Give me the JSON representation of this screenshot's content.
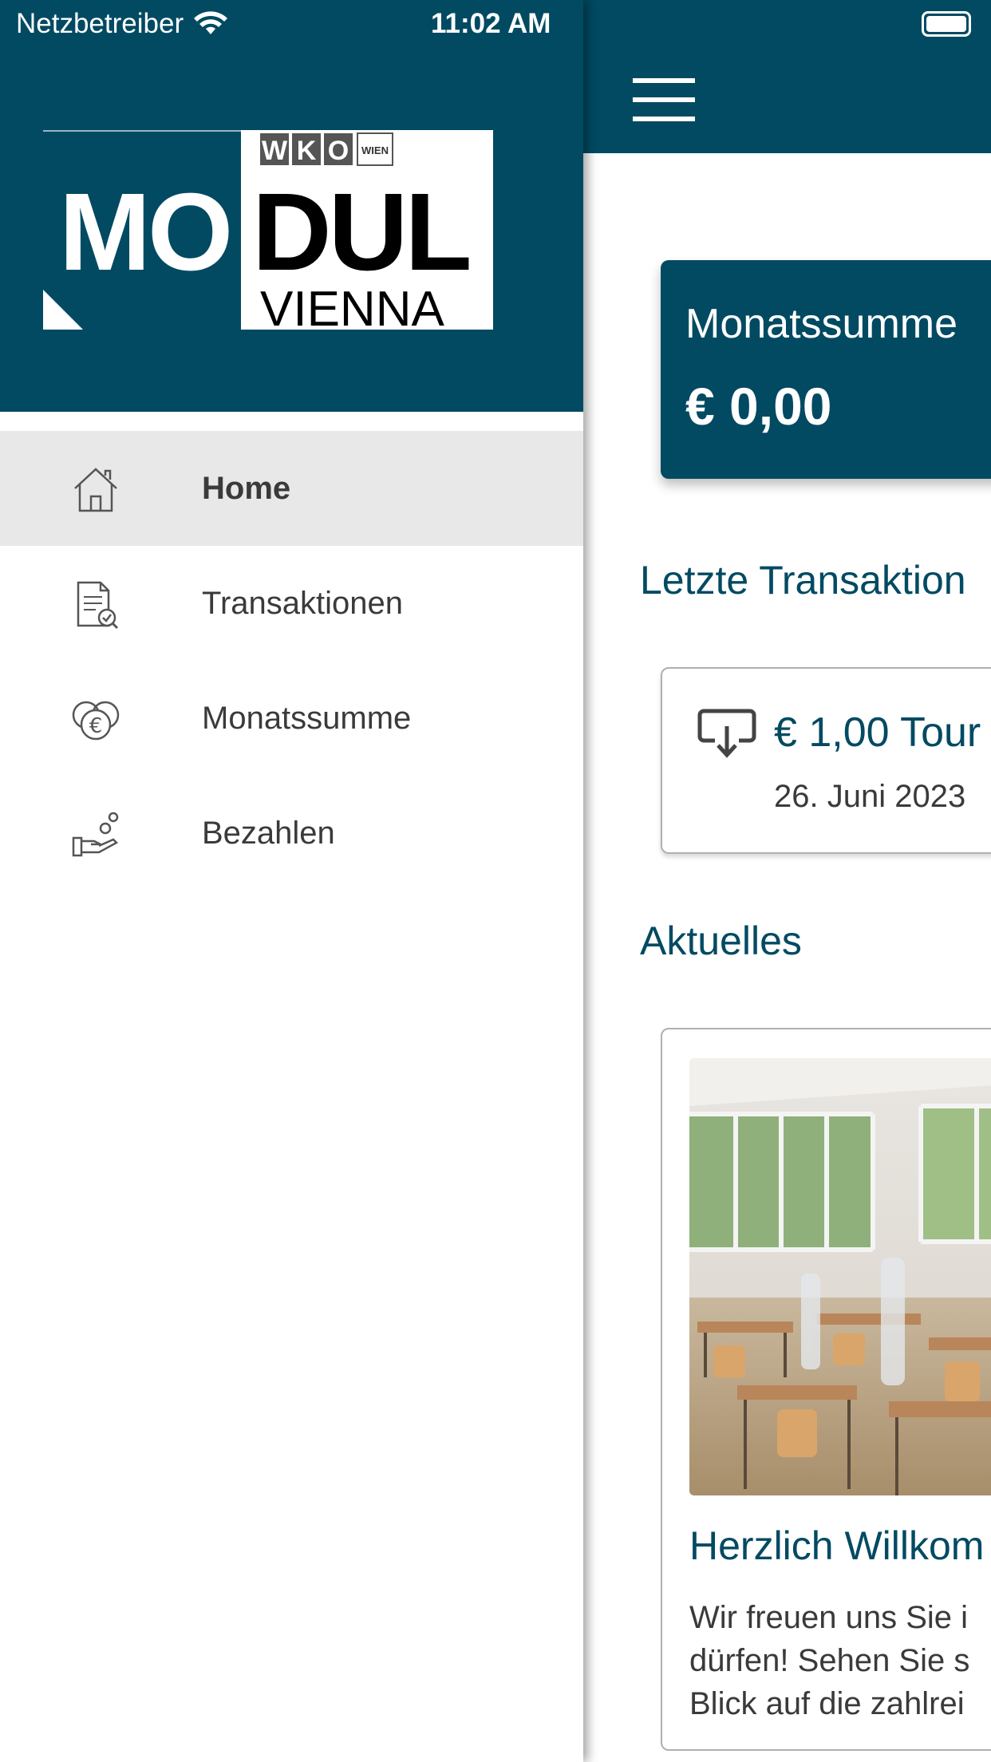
{
  "status_bar": {
    "carrier": "Netzbetreiber",
    "time": "11:02 AM"
  },
  "drawer": {
    "logo": {
      "top": "WKO",
      "badge": "WIEN",
      "line1_a": "MO",
      "line1_b": "DUL",
      "line2": "VIENNA"
    },
    "items": [
      {
        "label": "Home",
        "icon": "home-icon",
        "active": true
      },
      {
        "label": "Transaktionen",
        "icon": "document-check-icon",
        "active": false
      },
      {
        "label": "Monatssumme",
        "icon": "coins-euro-icon",
        "active": false
      },
      {
        "label": "Bezahlen",
        "icon": "hand-pay-icon",
        "active": false
      }
    ]
  },
  "main": {
    "monthly_sum": {
      "label": "Monatssumme",
      "value": "€ 0,00"
    },
    "recent_transactions_title": "Letzte Transaktion",
    "transaction": {
      "amount": "€ 1,00 Tour",
      "date": "26. Juni 2023"
    },
    "news_title": "Aktuelles",
    "news_item": {
      "title": "Herzlich Willkom",
      "text_lines": [
        "Wir freuen uns Sie i",
        "dürfen! Sehen Sie s",
        "Blick auf die zahlrei"
      ]
    }
  },
  "colors": {
    "brand": "#014a62",
    "active_bg": "#e8e8e8"
  }
}
